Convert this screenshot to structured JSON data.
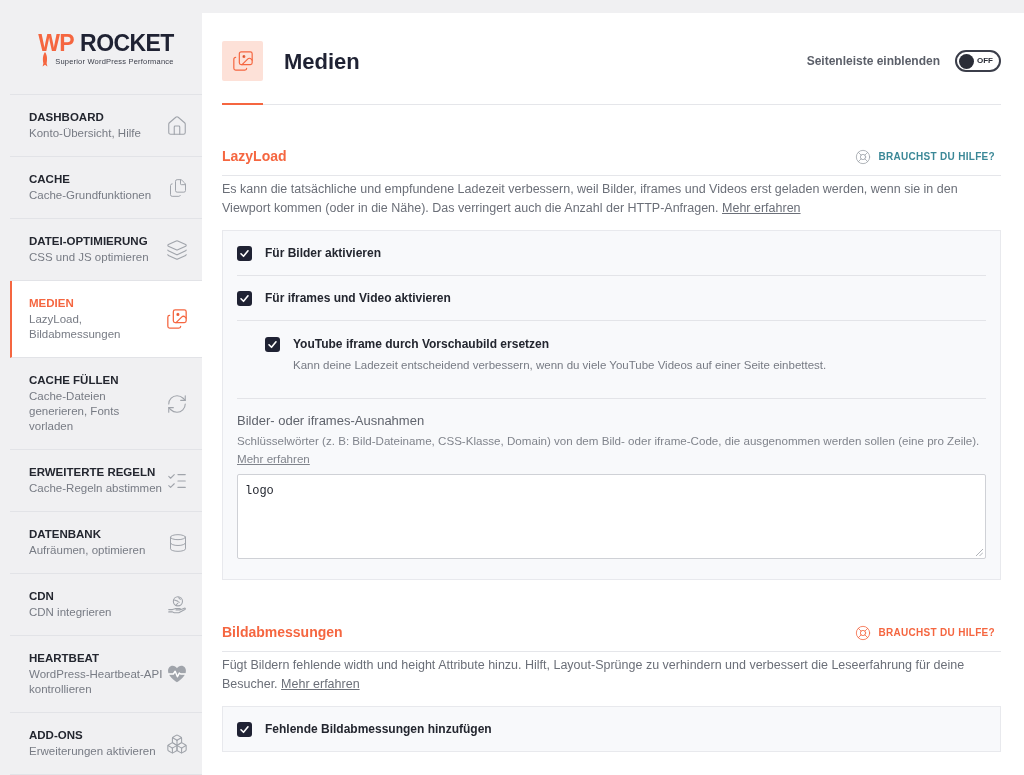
{
  "sidebar": {
    "logo": {
      "prefix": "WP",
      "name": "ROCKET",
      "tagline": "Superior WordPress Performance"
    },
    "items": [
      {
        "title": "DASHBOARD",
        "subtitle": "Konto-Übersicht, Hilfe",
        "selected": false
      },
      {
        "title": "CACHE",
        "subtitle": "Cache-Grundfunktionen",
        "selected": false
      },
      {
        "title": "DATEI-OPTIMIERUNG",
        "subtitle": "CSS und JS optimieren",
        "selected": false
      },
      {
        "title": "MEDIEN",
        "subtitle": "LazyLoad, Bildabmessungen",
        "selected": true
      },
      {
        "title": "CACHE FÜLLEN",
        "subtitle": "Cache-Dateien generieren, Fonts vorladen",
        "selected": false
      },
      {
        "title": "ERWEITERTE REGELN",
        "subtitle": "Cache-Regeln abstimmen",
        "selected": false
      },
      {
        "title": "DATENBANK",
        "subtitle": "Aufräumen, optimieren",
        "selected": false
      },
      {
        "title": "CDN",
        "subtitle": "CDN integrieren",
        "selected": false
      },
      {
        "title": "HEARTBEAT",
        "subtitle": "WordPress-Heartbeat-API kontrollieren",
        "selected": false
      },
      {
        "title": "ADD-ONS",
        "subtitle": "Erweiterungen aktivieren",
        "selected": false
      }
    ]
  },
  "header": {
    "title": "Medien",
    "sidebar_toggle": {
      "label": "Seitenleiste einblenden",
      "on": false,
      "state_text": "OFF"
    }
  },
  "sections": [
    {
      "title": "LazyLoad",
      "help": {
        "label": "BRAUCHST DU HILFE?",
        "highlighted": false
      },
      "description": "Es kann die tatsächliche und empfundene Ladezeit verbessern, weil Bilder, iframes und Videos erst geladen werden, wenn sie in den Viewport kommen (oder in die Nähe). Das verringert auch die Anzahl der HTTP-Anfragen.",
      "link": "Mehr erfahren",
      "options": [
        {
          "label": "Für Bilder aktivieren",
          "checked": true
        },
        {
          "label": "Für iframes und Video aktivieren",
          "checked": true,
          "children": [
            {
              "label": "YouTube iframe durch Vorschaubild ersetzen",
              "checked": true,
              "description": "Kann deine Ladezeit entscheidend verbessern, wenn du viele YouTube Videos auf einer Seite einbettest."
            }
          ]
        }
      ],
      "exclusions": {
        "label": "Bilder- oder iframes-Ausnahmen",
        "description": "Schlüsselwörter (z. B: Bild-Dateiname, CSS-Klasse, Domain) von dem Bild- oder iframe-Code, die ausgenommen werden sollen (eine pro Zeile).",
        "link": "Mehr erfahren",
        "value": "logo"
      }
    },
    {
      "title": "Bildabmessungen",
      "help": {
        "label": "BRAUCHST DU HILFE?",
        "highlighted": true
      },
      "description": "Fügt Bildern fehlende width und height Attribute hinzu. Hilft, Layout-Sprünge zu verhindern und verbessert die Leseerfahrung für deine Besucher.",
      "link": "Mehr erfahren",
      "options": [
        {
          "label": "Fehlende Bildabmessungen hinzufügen",
          "checked": true
        }
      ]
    }
  ]
}
